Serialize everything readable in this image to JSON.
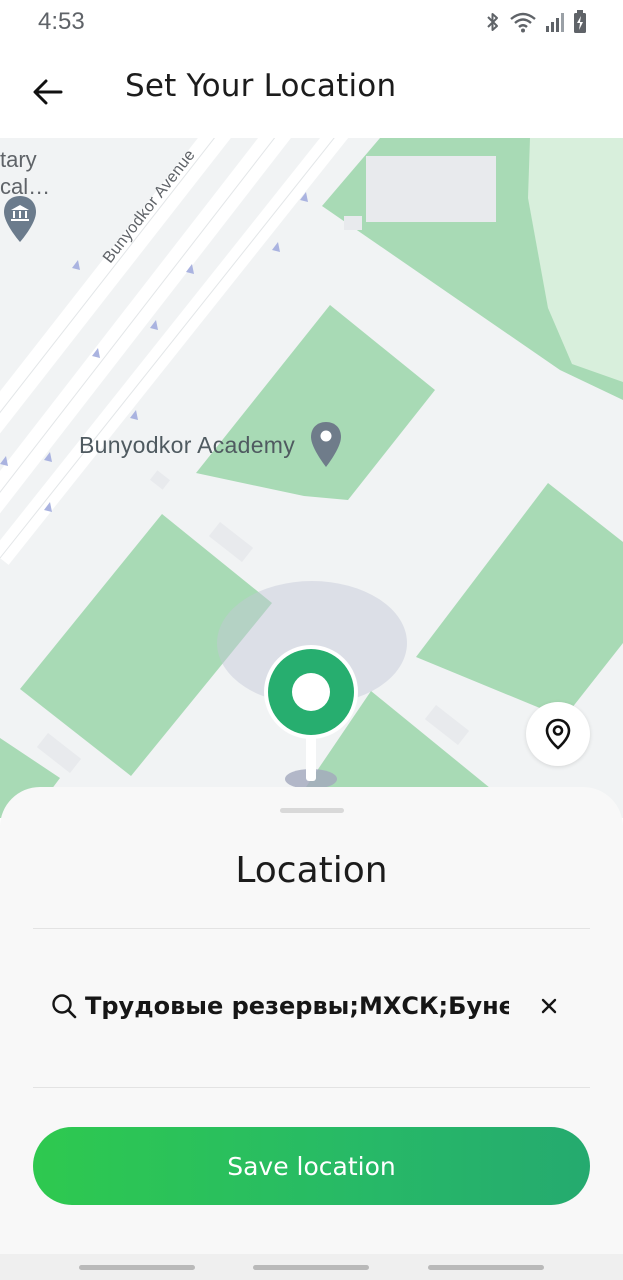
{
  "status_bar": {
    "time": "4:53",
    "icons": [
      "bluetooth-icon",
      "wifi-icon",
      "signal-icon",
      "battery-charging-icon"
    ]
  },
  "header": {
    "back_icon": "arrow-left-icon",
    "title": "Set Your Location"
  },
  "map": {
    "labels": {
      "top_left_line1": "tary",
      "top_left_line2": "cal…",
      "street": "Bunyodkor Avenue",
      "poi": "Bunyodkor Academy"
    },
    "colors": {
      "land": "#f1f3f4",
      "park": "#a8dab5",
      "pin_accent": "#27ae6f"
    },
    "my_location_icon": "location-pin-outline-icon"
  },
  "sheet": {
    "title": "Location",
    "search": {
      "value": "Трудовые резервы;МХСК;Бунедкор",
      "icon": "search-icon",
      "clear_icon": "close-icon"
    },
    "save_label": "Save location",
    "colors": {
      "button_start": "#2ec94f",
      "button_end": "#25aa6f"
    }
  }
}
